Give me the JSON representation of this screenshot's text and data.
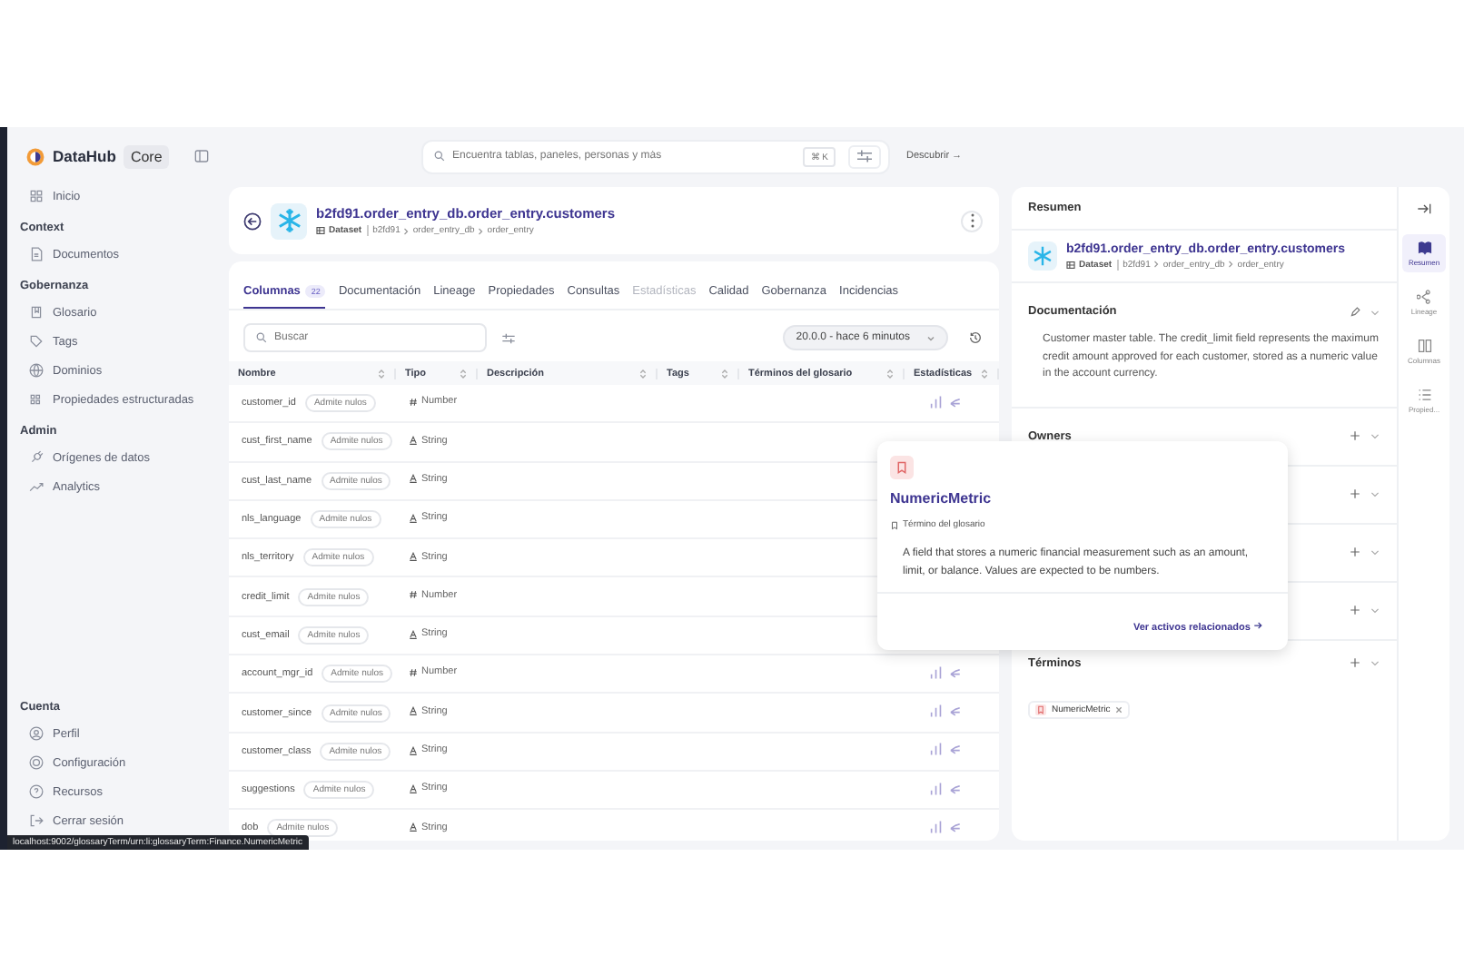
{
  "app": {
    "name": "DataHub",
    "edition": "Core"
  },
  "sidebar": {
    "sections": [
      {
        "items": [
          {
            "label": "Inicio"
          }
        ]
      },
      {
        "title": "Context",
        "items": [
          {
            "label": "Documentos"
          }
        ]
      },
      {
        "title": "Gobernanza",
        "items": [
          {
            "label": "Glosario"
          },
          {
            "label": "Tags"
          },
          {
            "label": "Dominios"
          },
          {
            "label": "Propiedades estructuradas"
          }
        ]
      },
      {
        "title": "Admin",
        "items": [
          {
            "label": "Orígenes de datos"
          },
          {
            "label": "Analytics"
          }
        ]
      }
    ],
    "footer": {
      "title": "Cuenta",
      "items": [
        {
          "label": "Perfil"
        },
        {
          "label": "Configuración"
        },
        {
          "label": "Recursos"
        },
        {
          "label": "Cerrar sesión"
        }
      ]
    }
  },
  "search": {
    "placeholder": "Encuentra tablas, paneles, personas y más",
    "shortcut": "⌘ K",
    "discover": "Descubrir →"
  },
  "entity": {
    "name": "b2fd91.order_entry_db.order_entry.customers",
    "type": "Dataset",
    "path": [
      "b2fd91",
      "order_entry_db",
      "order_entry"
    ]
  },
  "tabs": [
    {
      "label": "Columnas",
      "count": "22",
      "selected": true,
      "disabled": false
    },
    {
      "label": "Documentación",
      "selected": false,
      "disabled": false
    },
    {
      "label": "Lineage",
      "selected": false,
      "disabled": false
    },
    {
      "label": "Propiedades",
      "selected": false,
      "disabled": false
    },
    {
      "label": "Consultas",
      "selected": false,
      "disabled": false
    },
    {
      "label": "Estadísticas",
      "selected": false,
      "disabled": true
    },
    {
      "label": "Calidad",
      "selected": false,
      "disabled": false
    },
    {
      "label": "Gobernanza",
      "selected": false,
      "disabled": false
    },
    {
      "label": "Incidencias",
      "selected": false,
      "disabled": false
    }
  ],
  "column_search": {
    "placeholder": "Buscar"
  },
  "version": "20.0.0 - hace 6 minutos",
  "table": {
    "columns": [
      "Nombre",
      "Tipo",
      "Descripción",
      "Tags",
      "Términos del glosario",
      "Estadísticas"
    ],
    "rows": [
      {
        "name": "customer_id",
        "badge": "Admite nulos",
        "kind": "number",
        "type": "Number"
      },
      {
        "name": "cust_first_name",
        "badge": "Admite nulos",
        "kind": "string",
        "type": "String",
        "stats_hidden": true
      },
      {
        "name": "cust_last_name",
        "badge": "Admite nulos",
        "kind": "string",
        "type": "String",
        "stats_hidden": true
      },
      {
        "name": "nls_language",
        "badge": "Admite nulos",
        "kind": "string",
        "type": "String",
        "stats_hidden": true
      },
      {
        "name": "nls_territory",
        "badge": "Admite nulos",
        "kind": "string",
        "type": "String",
        "stats_hidden": true
      },
      {
        "name": "credit_limit",
        "badge": "Admite nulos",
        "kind": "number",
        "type": "Number"
      },
      {
        "name": "cust_email",
        "badge": "Admite nulos",
        "kind": "string",
        "type": "String"
      },
      {
        "name": "account_mgr_id",
        "badge": "Admite nulos",
        "kind": "number",
        "type": "Number"
      },
      {
        "name": "customer_since",
        "badge": "Admite nulos",
        "kind": "string",
        "type": "String"
      },
      {
        "name": "customer_class",
        "badge": "Admite nulos",
        "kind": "string",
        "type": "String"
      },
      {
        "name": "suggestions",
        "badge": "Admite nulos",
        "kind": "string",
        "type": "String"
      },
      {
        "name": "dob",
        "badge": "Admite nulos",
        "kind": "string",
        "type": "String"
      }
    ]
  },
  "summary": {
    "title": "Resumen",
    "documentation_title": "Documentación",
    "documentation": "Customer master table. The credit_limit field represents the maximum credit amount approved for each customer, stored as a numeric value in the account currency.",
    "entity": {
      "name": "b2fd91.order_entry_db.order_entry.customers",
      "type": "Dataset",
      "path": [
        "b2fd91",
        "order_entry_db",
        "order_entry"
      ]
    },
    "sections": [
      {
        "title": "Owners",
        "addable": true
      },
      {
        "addable": true
      },
      {
        "addable": true
      },
      {
        "addable": true
      },
      {
        "title": "Términos",
        "addable": true,
        "term": "NumericMetric"
      }
    ]
  },
  "rail": [
    {
      "label": "Resumen",
      "selected": true
    },
    {
      "label": "Lineage",
      "selected": false
    },
    {
      "label": "Columnas",
      "selected": false
    },
    {
      "label": "Propied...",
      "selected": false
    }
  ],
  "popup": {
    "title": "NumericMetric",
    "type": "Término del glosario",
    "description": "A field that stores a numeric financial measurement such as an amount, limit, or balance. Values are expected to be numbers.",
    "link": "Ver activos relacionados"
  },
  "status_url": "localhost:9002/glossaryTerm/urn:li:glossaryTerm:Finance.NumericMetric"
}
